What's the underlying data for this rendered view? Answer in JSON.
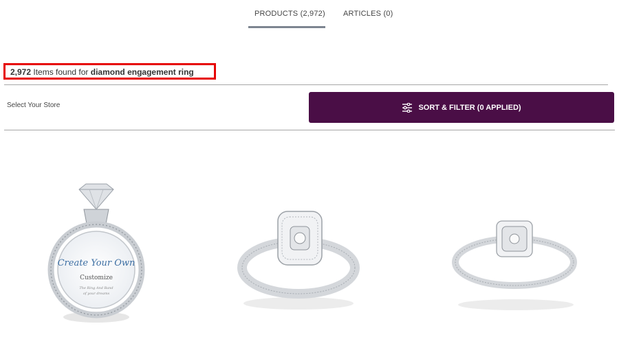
{
  "tabs": {
    "products": "PRODUCTS (2,972)",
    "articles": "ARTICLES (0)"
  },
  "results": {
    "count": "2,972",
    "middle": " Items found for ",
    "query": "diamond engagement ring"
  },
  "store_label": "Select Your Store",
  "filter_button": {
    "label": "SORT & FILTER (0 APPLIED)",
    "icon": "sliders-icon"
  },
  "products": [
    {
      "type": "customize-ring",
      "script_text": "Create Your Own",
      "sub_text": "Customize",
      "small_text_1": "The Ring And Band",
      "small_text_2": "of your dreams"
    },
    {
      "type": "cushion-halo-split-shank-ring"
    },
    {
      "type": "cushion-halo-ring"
    }
  ],
  "colors": {
    "accent": "#4a0e46",
    "highlight_box": "#e60000",
    "tab_underline": "#7d8590"
  }
}
